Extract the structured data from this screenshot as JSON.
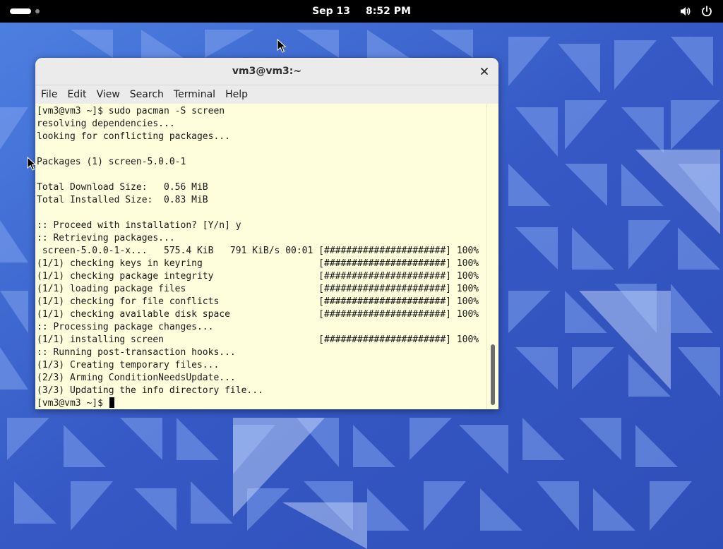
{
  "topbar": {
    "date": "Sep 13",
    "time": "8:52 PM",
    "volume_icon": "volume-icon",
    "power_icon": "power-icon"
  },
  "terminal": {
    "title": "vm3@vm3:~",
    "menu": [
      "File",
      "Edit",
      "View",
      "Search",
      "Terminal",
      "Help"
    ],
    "lines": [
      "[vm3@vm3 ~]$ sudo pacman -S screen",
      "resolving dependencies...",
      "looking for conflicting packages...",
      "",
      "Packages (1) screen-5.0.0-1",
      "",
      "Total Download Size:   0.56 MiB",
      "Total Installed Size:  0.83 MiB",
      "",
      ":: Proceed with installation? [Y/n] y",
      ":: Retrieving packages...",
      " screen-5.0.0-1-x...   575.4 KiB   791 KiB/s 00:01 [######################] 100%",
      "(1/1) checking keys in keyring                     [######################] 100%",
      "(1/1) checking package integrity                   [######################] 100%",
      "(1/1) loading package files                        [######################] 100%",
      "(1/1) checking for file conflicts                  [######################] 100%",
      "(1/1) checking available disk space                [######################] 100%",
      ":: Processing package changes...",
      "(1/1) installing screen                            [######################] 100%",
      ":: Running post-transaction hooks...",
      "(1/3) Creating temporary files...",
      "(2/3) Arming ConditionNeedsUpdate...",
      "(3/3) Updating the info directory file..."
    ],
    "prompt": "[vm3@vm3 ~]$ ",
    "scroll_position": 1.0
  },
  "colors": {
    "terminal_bg": "#fefedc",
    "titlebar_bg": "#ebebeb",
    "wallpaper_base": "#3a63c8",
    "topbar_bg": "#000000"
  }
}
